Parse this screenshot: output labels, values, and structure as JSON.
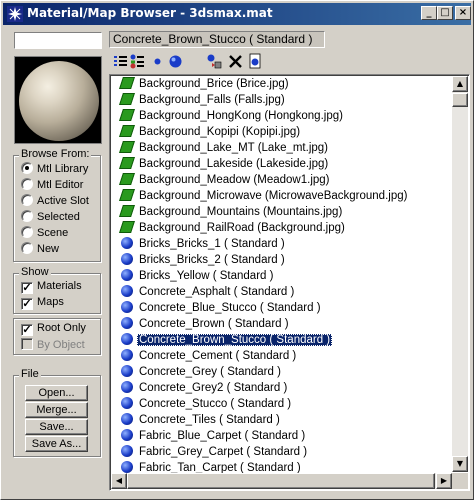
{
  "window": {
    "title": "Material/Map Browser - 3dsmax.mat",
    "title_icon": "3dsmax-star-icon",
    "controls": [
      "minimize",
      "maximize",
      "close"
    ]
  },
  "name_field": {
    "value": ""
  },
  "current_material": "Concrete_Brown_Stucco  ( Standard )",
  "toolbar": {
    "icons": [
      "view-list-icon",
      "view-list-icons-icon",
      "view-small-icons-icon",
      "view-large-icons-icon",
      "update-scene-materials-icon",
      "delete-icon",
      "clear-material-library-icon"
    ]
  },
  "browse_from": {
    "label": "Browse From:",
    "options": [
      "Mtl Library",
      "Mtl Editor",
      "Active Slot",
      "Selected",
      "Scene",
      "New"
    ],
    "selected": "Mtl Library"
  },
  "show": {
    "label": "Show",
    "materials_label": "Materials",
    "materials_checked": true,
    "maps_label": "Maps",
    "maps_checked": true
  },
  "root_only": {
    "label": "Root Only",
    "checked": true
  },
  "by_object": {
    "label": "By Object",
    "checked": false,
    "disabled": true
  },
  "file": {
    "label": "File",
    "buttons": [
      "Open...",
      "Merge...",
      "Save...",
      "Save As..."
    ]
  },
  "list": {
    "items": [
      {
        "type": "map",
        "text": "Background_Brice (Brice.jpg)"
      },
      {
        "type": "map",
        "text": "Background_Falls (Falls.jpg)"
      },
      {
        "type": "map",
        "text": "Background_HongKong (Hongkong.jpg)"
      },
      {
        "type": "map",
        "text": "Background_Kopipi (Kopipi.jpg)"
      },
      {
        "type": "map",
        "text": "Background_Lake_MT (Lake_mt.jpg)"
      },
      {
        "type": "map",
        "text": "Background_Lakeside (Lakeside.jpg)"
      },
      {
        "type": "map",
        "text": "Background_Meadow (Meadow1.jpg)"
      },
      {
        "type": "map",
        "text": "Background_Microwave (MicrowaveBackground.jpg)"
      },
      {
        "type": "map",
        "text": "Background_Mountains (Mountains.jpg)"
      },
      {
        "type": "map",
        "text": "Background_RailRoad (Background.jpg)"
      },
      {
        "type": "mtl",
        "text": "Bricks_Bricks_1  ( Standard )"
      },
      {
        "type": "mtl",
        "text": "Bricks_Bricks_2  ( Standard )"
      },
      {
        "type": "mtl",
        "text": "Bricks_Yellow  ( Standard )"
      },
      {
        "type": "mtl",
        "text": "Concrete_Asphalt  ( Standard )"
      },
      {
        "type": "mtl",
        "text": "Concrete_Blue_Stucco  ( Standard )"
      },
      {
        "type": "mtl",
        "text": "Concrete_Brown  ( Standard )"
      },
      {
        "type": "mtl",
        "text": "Concrete_Brown_Stucco  ( Standard )",
        "selected": true
      },
      {
        "type": "mtl",
        "text": "Concrete_Cement  ( Standard )"
      },
      {
        "type": "mtl",
        "text": "Concrete_Grey  ( Standard )"
      },
      {
        "type": "mtl",
        "text": "Concrete_Grey2  ( Standard )"
      },
      {
        "type": "mtl",
        "text": "Concrete_Stucco  ( Standard )"
      },
      {
        "type": "mtl",
        "text": "Concrete_Tiles  ( Standard )"
      },
      {
        "type": "mtl",
        "text": "Fabric_Blue_Carpet  ( Standard )"
      },
      {
        "type": "mtl",
        "text": "Fabric_Grey_Carpet  ( Standard )"
      },
      {
        "type": "mtl",
        "text": "Fabric_Tan_Carpet  ( Standard )"
      }
    ]
  },
  "colors": {
    "title_start": "#0a246a",
    "title_end": "#3a6ea5",
    "selection": "#0a246a",
    "map_icon": "#2a9a1e",
    "material_icon": "#1a3cc8"
  }
}
